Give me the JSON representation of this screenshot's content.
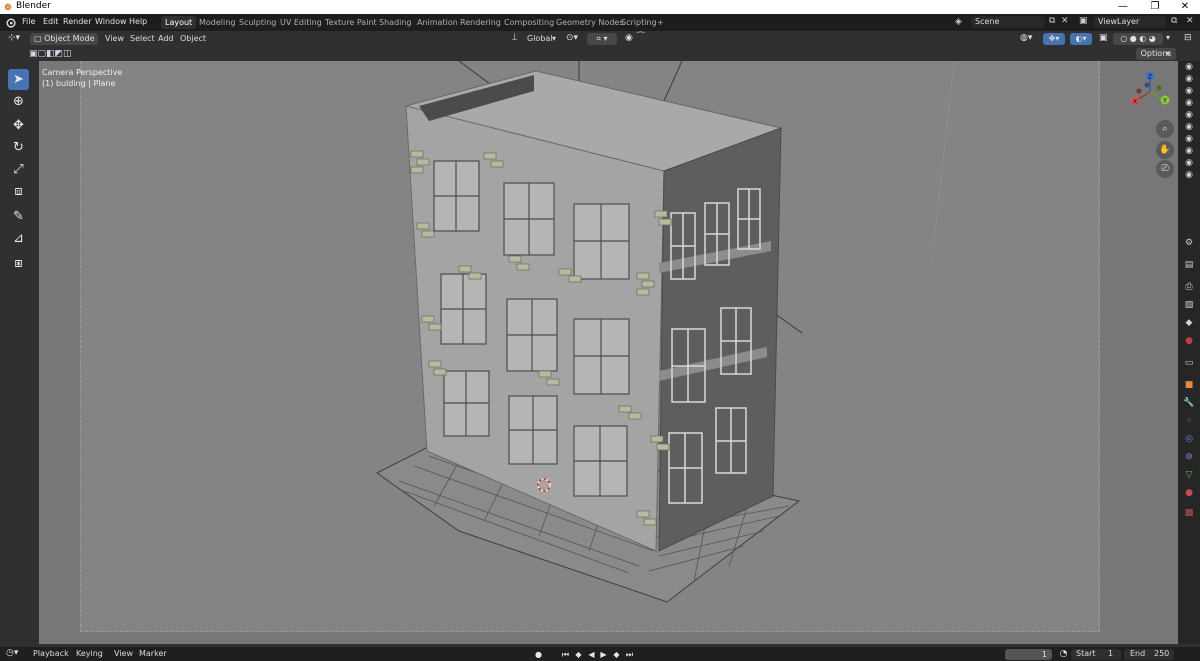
{
  "window": {
    "title": "Blender",
    "controls": [
      "—",
      "❐",
      "✕"
    ]
  },
  "menu": {
    "items": [
      "File",
      "Edit",
      "Render",
      "Window",
      "Help"
    ],
    "workspaces": [
      "Layout",
      "Modeling",
      "Sculpting",
      "UV Editing",
      "Texture Paint",
      "Shading",
      "Animation",
      "Rendering",
      "Compositing",
      "Geometry Nodes",
      "Scripting",
      "+"
    ],
    "active_workspace": "Layout",
    "scene": "Scene",
    "view_layer": "ViewLayer"
  },
  "viewport_header": {
    "mode": "Object Mode",
    "menus": [
      "View",
      "Select",
      "Add",
      "Object"
    ],
    "orientation": "Global",
    "options_label": "Options"
  },
  "viewport": {
    "camera_label": "Camera Perspective",
    "object_label": "(1) bulding | Plane",
    "gizmo_axes": {
      "x": "X",
      "y": "Y",
      "z": "Z"
    },
    "colors": {
      "background": "#777777",
      "camera_frame": "#848484",
      "building_light": "#a7a7a7",
      "building_dark": "#5c5c5c"
    }
  },
  "toolbar": {
    "tools": [
      "select-box",
      "cursor",
      "move",
      "rotate",
      "scale",
      "transform",
      "annotate",
      "measure",
      "add-cube"
    ]
  },
  "timeline": {
    "menus": [
      "Playback",
      "Keying",
      "View",
      "Marker"
    ],
    "current_frame": "1",
    "start_label": "Start",
    "start_value": "1",
    "end_label": "End",
    "end_value": "250"
  },
  "colors": {
    "accent": "#4772b3",
    "header": "#303030",
    "menubar": "#1d1d1d"
  }
}
